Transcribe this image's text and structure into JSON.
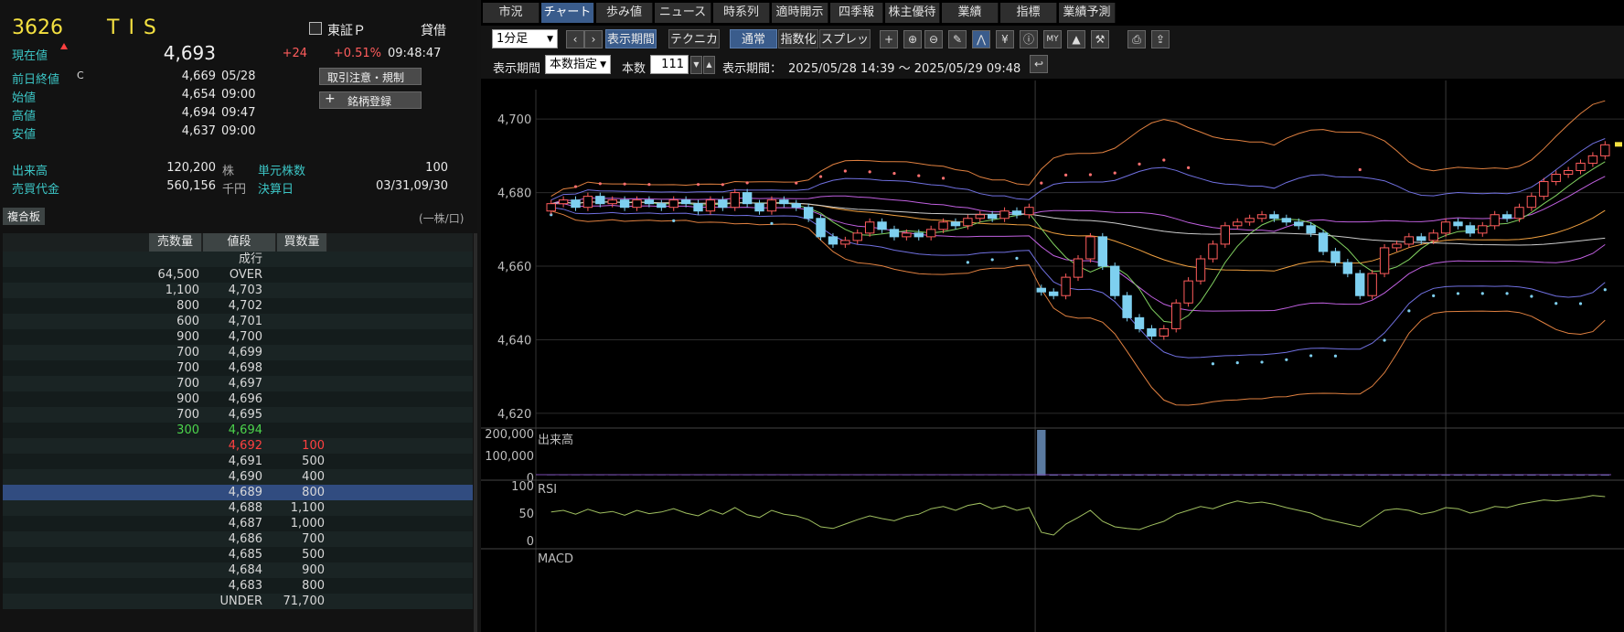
{
  "quote": {
    "code": "3626",
    "name": "TIS",
    "market": "東証Ｐ",
    "margin_type": "貸借",
    "current_label": "現在値",
    "current_price": "4,693",
    "change": "+24",
    "change_pct": "+0.51%",
    "time": "09:48:47",
    "prev_close_label": "前日終値",
    "prev_close_mark": "C",
    "prev_close": "4,669",
    "prev_close_date": "05/28",
    "open_label": "始値",
    "open": "4,654",
    "open_time": "09:00",
    "high_label": "高値",
    "high": "4,694",
    "high_time": "09:47",
    "low_label": "安値",
    "low": "4,637",
    "low_time": "09:00",
    "notice_button": "取引注意・規制",
    "register_button": "銘柄登録",
    "volume_label": "出来高",
    "volume": "120,200",
    "volume_unit": "株",
    "unit_shares_label": "単元株数",
    "unit_shares": "100",
    "turnover_label": "売買代金",
    "turnover": "560,156",
    "turnover_unit": "千円",
    "settlement_label": "決算日",
    "settlement": "03/31,09/30"
  },
  "book": {
    "tab_label": "複合板",
    "unit_note": "(一株/口)",
    "headers": {
      "sell": "売数量",
      "price": "値段",
      "buy": "買数量"
    },
    "rows": [
      {
        "sell": "",
        "price": "成行",
        "buy": ""
      },
      {
        "sell": "64,500",
        "price": "OVER",
        "buy": ""
      },
      {
        "sell": "1,100",
        "price": "4,703",
        "buy": ""
      },
      {
        "sell": "800",
        "price": "4,702",
        "buy": ""
      },
      {
        "sell": "600",
        "price": "4,701",
        "buy": ""
      },
      {
        "sell": "900",
        "price": "4,700",
        "buy": ""
      },
      {
        "sell": "700",
        "price": "4,699",
        "buy": ""
      },
      {
        "sell": "700",
        "price": "4,698",
        "buy": ""
      },
      {
        "sell": "700",
        "price": "4,697",
        "buy": ""
      },
      {
        "sell": "900",
        "price": "4,696",
        "buy": ""
      },
      {
        "sell": "700",
        "price": "4,695",
        "buy": ""
      },
      {
        "sell": "300",
        "price": "4,694",
        "buy": "",
        "tone": "green"
      },
      {
        "sell": "",
        "price": "4,692",
        "buy": "100",
        "tone": "red"
      },
      {
        "sell": "",
        "price": "4,691",
        "buy": "500"
      },
      {
        "sell": "",
        "price": "4,690",
        "buy": "400"
      },
      {
        "sell": "",
        "price": "4,689",
        "buy": "800",
        "selected": true
      },
      {
        "sell": "",
        "price": "4,688",
        "buy": "1,100"
      },
      {
        "sell": "",
        "price": "4,687",
        "buy": "1,000"
      },
      {
        "sell": "",
        "price": "4,686",
        "buy": "700"
      },
      {
        "sell": "",
        "price": "4,685",
        "buy": "500"
      },
      {
        "sell": "",
        "price": "4,684",
        "buy": "900"
      },
      {
        "sell": "",
        "price": "4,683",
        "buy": "800"
      },
      {
        "sell": "",
        "price": "UNDER",
        "buy": "71,700"
      }
    ]
  },
  "tabs": [
    "市況",
    "チャート",
    "歩み値",
    "ニュース",
    "時系列",
    "適時開示",
    "四季報",
    "株主優待",
    "業績",
    "指標",
    "業績予測"
  ],
  "active_tab": 1,
  "toolbar": {
    "interval": "1分足",
    "display_period_btn": "表示期間",
    "technical_btn": "テクニカル",
    "normal_btn": "通常",
    "index_btn": "指数化",
    "spread_btn": "スプレッド",
    "period_label": "表示期間",
    "period_mode": "本数指定",
    "count_label": "本数",
    "count": "111",
    "range_label": "表示期間：",
    "range": "2025/05/28 14:39 ～ 2025/05/29 09:48"
  },
  "chart": {
    "price_ticks": [
      "4,700",
      "4,680",
      "4,660",
      "4,640",
      "4,620"
    ],
    "volume_label": "出来高",
    "volume_ticks": [
      "200,000",
      "100,000",
      "0"
    ],
    "rsi_label": "RSI",
    "rsi_ticks": [
      "100",
      "50",
      "0"
    ],
    "macd_label": "MACD"
  },
  "colors": {
    "up": "#ff5c5c",
    "down": "#7ed0f0",
    "accent": "#3a5c8c",
    "label": "#3cc6c6",
    "code": "#f4e040"
  },
  "chart_data": {
    "type": "candlestick",
    "interval": "1m",
    "ylim": [
      4616,
      4708
    ],
    "x_range": [
      "2025/05/28 14:39",
      "2025/05/29 09:48"
    ],
    "session_break_index": 40,
    "close": [
      4677,
      4678,
      4676,
      4679,
      4677,
      4678,
      4676,
      4678,
      4677,
      4676,
      4678,
      4677,
      4675,
      4678,
      4676,
      4680,
      4677,
      4675,
      4678,
      4677,
      4676,
      4673,
      4668,
      4666,
      4667,
      4669,
      4672,
      4670,
      4668,
      4669,
      4668,
      4670,
      4672,
      4671,
      4673,
      4674,
      4673,
      4675,
      4674,
      4676,
      4653,
      4652,
      4657,
      4662,
      4668,
      4660,
      4652,
      4646,
      4643,
      4641,
      4643,
      4650,
      4656,
      4662,
      4666,
      4671,
      4672,
      4673,
      4674,
      4673,
      4672,
      4671,
      4669,
      4664,
      4661,
      4658,
      4652,
      4658,
      4665,
      4666,
      4668,
      4667,
      4669,
      4672,
      4671,
      4669,
      4671,
      4674,
      4673,
      4676,
      4679,
      4683,
      4685,
      4686,
      4688,
      4690,
      4693
    ],
    "open": [
      4675,
      4677,
      4678,
      4676,
      4679,
      4677,
      4678,
      4676,
      4678,
      4677,
      4676,
      4678,
      4677,
      4675,
      4678,
      4676,
      4680,
      4677,
      4675,
      4678,
      4677,
      4676,
      4673,
      4668,
      4666,
      4667,
      4669,
      4672,
      4670,
      4668,
      4669,
      4668,
      4670,
      4672,
      4671,
      4673,
      4674,
      4673,
      4675,
      4674,
      4654,
      4653,
      4652,
      4657,
      4662,
      4668,
      4660,
      4652,
      4646,
      4643,
      4641,
      4643,
      4650,
      4656,
      4662,
      4666,
      4671,
      4672,
      4673,
      4674,
      4673,
      4672,
      4671,
      4669,
      4664,
      4661,
      4658,
      4652,
      4658,
      4665,
      4666,
      4668,
      4667,
      4669,
      4672,
      4671,
      4669,
      4671,
      4674,
      4673,
      4676,
      4679,
      4683,
      4685,
      4686,
      4688,
      4690
    ],
    "volume_spike": {
      "index": 40,
      "value": 200000
    },
    "rsi": [
      52,
      55,
      48,
      57,
      50,
      53,
      46,
      55,
      49,
      52,
      58,
      50,
      45,
      56,
      48,
      60,
      47,
      42,
      55,
      48,
      45,
      38,
      25,
      22,
      30,
      38,
      45,
      40,
      36,
      44,
      48,
      58,
      62,
      55,
      64,
      68,
      58,
      63,
      55,
      60,
      15,
      10,
      30,
      42,
      55,
      35,
      25,
      22,
      20,
      28,
      35,
      48,
      55,
      62,
      58,
      66,
      72,
      68,
      70,
      66,
      60,
      55,
      50,
      40,
      35,
      30,
      25,
      40,
      55,
      58,
      55,
      48,
      52,
      60,
      58,
      50,
      55,
      62,
      60,
      66,
      70,
      74,
      72,
      75,
      78,
      82,
      80
    ]
  }
}
